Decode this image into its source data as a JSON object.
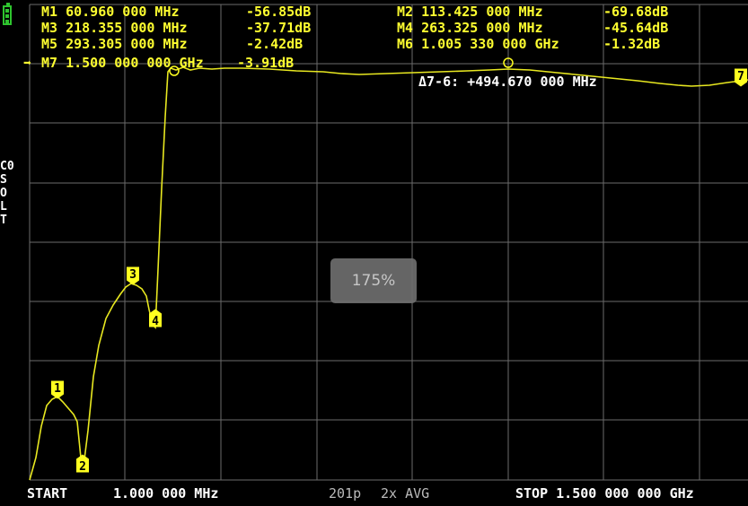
{
  "markers_readout": [
    {
      "label": "M1 60.960 000 MHz",
      "value": "-56.85dB"
    },
    {
      "label": "M2 113.425 000 MHz",
      "value": "-69.68dB"
    },
    {
      "label": "M3 218.355 000 MHz",
      "value": "-37.71dB"
    },
    {
      "label": "M4 263.325 000 MHz",
      "value": "-45.64dB"
    },
    {
      "label": "M5 293.305 000 MHz",
      "value": "-2.42dB"
    },
    {
      "label": "M6 1.005 330 000 GHz",
      "value": "-1.32dB"
    },
    {
      "label": "M7 1.500 000 000 GHz",
      "value": "-3.91dB"
    }
  ],
  "active_marker_arrow": "➡",
  "delta_readout": "Δ7-6: +494.670 000 MHz",
  "status_column": [
    "C0",
    "S",
    "O",
    "L",
    "T"
  ],
  "footer": {
    "start": "START",
    "start_freq": "1.000 000 MHz",
    "points": "201p",
    "avg": "2x AVG",
    "stop": "STOP 1.500 000 000 GHz"
  },
  "zoom_overlay": "175%",
  "marker_tags": [
    "1",
    "2",
    "3",
    "4",
    "7"
  ],
  "colors": {
    "trace": "#e8e820",
    "grid": "#6b6b6b",
    "marker_fill": "#ffff20",
    "battery": "#2ec42e"
  }
}
